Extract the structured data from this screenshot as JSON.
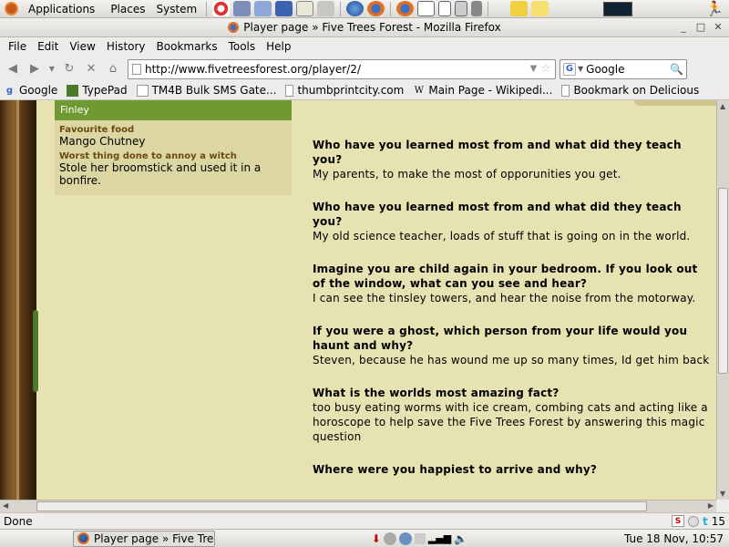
{
  "top_panel": {
    "menus": [
      "Applications",
      "Places",
      "System"
    ]
  },
  "window": {
    "title": "Player page » Five Trees Forest - Mozilla Firefox"
  },
  "menubar": [
    "File",
    "Edit",
    "View",
    "History",
    "Bookmarks",
    "Tools",
    "Help"
  ],
  "navbar": {
    "url": "http://www.fivetreesforest.org/player/2/",
    "search_engine": "Google"
  },
  "bookmarks": [
    {
      "label": "Google",
      "icon": "google-icon"
    },
    {
      "label": "TypePad",
      "icon": "typepad-icon"
    },
    {
      "label": "TM4B Bulk SMS Gate...",
      "icon": "page-icon"
    },
    {
      "label": "thumbprintcity.com",
      "icon": "page-icon"
    },
    {
      "label": "Main Page - Wikipedi...",
      "icon": "wikipedia-icon"
    },
    {
      "label": "Bookmark on Delicious",
      "icon": "page-icon"
    }
  ],
  "player": {
    "name": "Finley",
    "facts": [
      {
        "label": "Favourite food",
        "value": "Mango Chutney"
      },
      {
        "label": "Worst thing done to annoy a witch",
        "value": "Stole her broomstick and used it in a bonfire."
      }
    ]
  },
  "qa": [
    {
      "q": "Who have you learned most from and what did they teach you?",
      "a": "My parents, to make the most of opporunities you get."
    },
    {
      "q": "Who have you learned most from and what did they teach you?",
      "a": "My old science teacher, loads of stuff that is going on in the world."
    },
    {
      "q": "Imagine you are child again in your bedroom. If you look out of the window, what can you see and hear?",
      "a": "I can see the tinsley towers, and hear the noise from the motorway."
    },
    {
      "q": "If you were a ghost, which person from your life would you haunt and why?",
      "a": "Steven, because he has wound me up so many times, Id get him back"
    },
    {
      "q": "What is the worlds most amazing fact?",
      "a": "too busy eating worms with ice cream, combing cats and acting like a horoscope to help save the Five Trees Forest by answering this magic question"
    },
    {
      "q": "Where were you happiest to arrive and why?",
      "a": ""
    }
  ],
  "statusbar": {
    "text": "Done",
    "twitter_count": "15"
  },
  "taskbar": {
    "task_label": "Player page » Five Trees...",
    "clock": "Tue 18 Nov, 10:57"
  }
}
